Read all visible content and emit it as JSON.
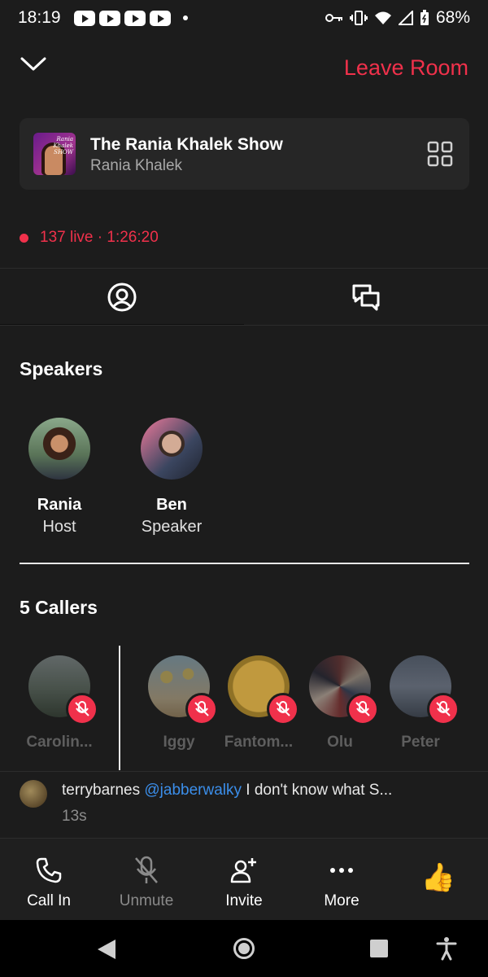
{
  "status_bar": {
    "time": "18:19",
    "battery": "68%",
    "notification_icons": [
      "youtube-icon",
      "youtube-icon",
      "youtube-icon",
      "youtube-icon"
    ]
  },
  "header": {
    "collapse_icon": "chevron-down-icon",
    "leave_label": "Leave Room"
  },
  "show": {
    "title": "The Rania Khalek Show",
    "host": "Rania Khalek",
    "thumb_text": "Rania Khalek SHOW",
    "layout_icon": "grid-icon"
  },
  "live": {
    "text": "137 live · 1:26:20"
  },
  "tabs": [
    {
      "name": "people",
      "icon": "person-circle-icon",
      "active": true
    },
    {
      "name": "chat",
      "icon": "chat-bubbles-icon",
      "active": false
    }
  ],
  "speakers": {
    "title": "Speakers",
    "items": [
      {
        "name": "Rania",
        "role": "Host"
      },
      {
        "name": "Ben",
        "role": "Speaker"
      }
    ]
  },
  "callers": {
    "title": "5 Callers",
    "items": [
      {
        "name": "Carolin..."
      },
      {
        "name": "Iggy"
      },
      {
        "name": "Fantom..."
      },
      {
        "name": "Olu"
      },
      {
        "name": "Peter"
      }
    ]
  },
  "comment": {
    "user": "terrybarnes",
    "mention": "@jabberwalky",
    "text": "I don't know what S...",
    "time": "13s"
  },
  "actions": {
    "call_in": "Call In",
    "unmute": "Unmute",
    "invite": "Invite",
    "more": "More",
    "thumb_emoji": "👍"
  },
  "colors": {
    "accent": "#f0314b",
    "background": "#1c1c1c",
    "mention": "#3b8eea"
  }
}
